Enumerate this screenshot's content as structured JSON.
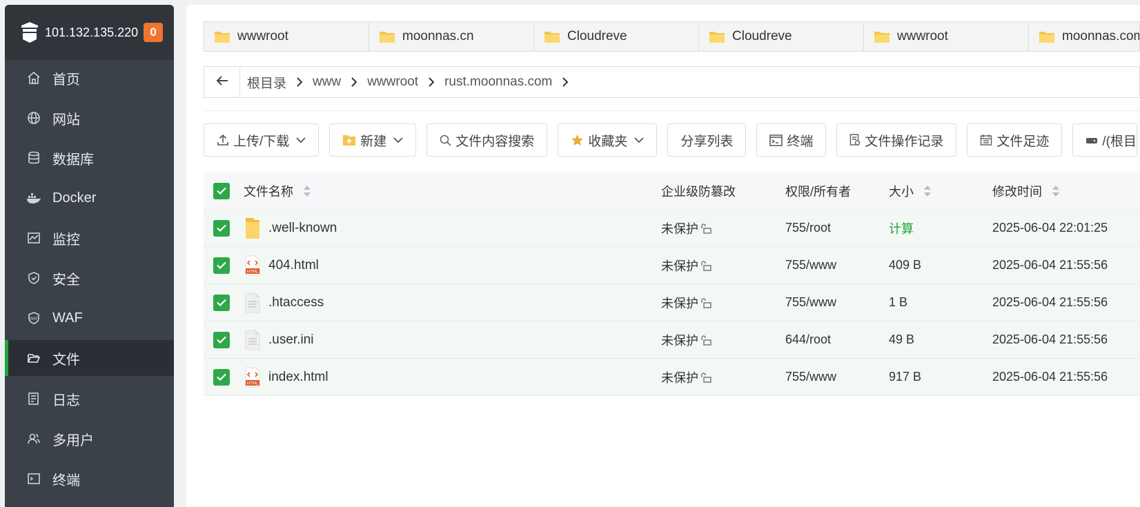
{
  "sidebar": {
    "host": "101.132.135.220",
    "badge": "0",
    "items": [
      {
        "label": "首页",
        "icon": "home-icon"
      },
      {
        "label": "网站",
        "icon": "globe-icon"
      },
      {
        "label": "数据库",
        "icon": "database-icon"
      },
      {
        "label": "Docker",
        "icon": "docker-icon"
      },
      {
        "label": "监控",
        "icon": "monitor-icon"
      },
      {
        "label": "安全",
        "icon": "shield-icon"
      },
      {
        "label": "WAF",
        "icon": "waf-icon"
      },
      {
        "label": "文件",
        "icon": "folder-open-icon",
        "active": true
      },
      {
        "label": "日志",
        "icon": "log-icon"
      },
      {
        "label": "多用户",
        "icon": "users-icon"
      },
      {
        "label": "终端",
        "icon": "terminal-icon"
      }
    ]
  },
  "tabs": [
    "wwwroot",
    "moonnas.cn",
    "Cloudreve",
    "Cloudreve",
    "wwwroot",
    "moonnas.com"
  ],
  "breadcrumb": [
    "根目录",
    "www",
    "wwwroot",
    "rust.moonnas.com"
  ],
  "toolbar": {
    "upload": "上传/下载",
    "new": "新建",
    "search": "文件内容搜索",
    "favorites": "收藏夹",
    "share": "分享列表",
    "terminal": "终端",
    "oplog": "文件操作记录",
    "footprint": "文件足迹",
    "disk": "/(根目"
  },
  "table": {
    "headers": {
      "name": "文件名称",
      "protect": "企业级防篡改",
      "perm": "权限/所有者",
      "size": "大小",
      "mtime": "修改时间"
    },
    "rows": [
      {
        "name": ".well-known",
        "type": "folder",
        "protect": "未保护",
        "perm": "755/root",
        "size": "计算",
        "mtime": "2025-06-04 22:01:25"
      },
      {
        "name": "404.html",
        "type": "html",
        "protect": "未保护",
        "perm": "755/www",
        "size": "409 B",
        "mtime": "2025-06-04 21:55:56"
      },
      {
        "name": ".htaccess",
        "type": "text",
        "protect": "未保护",
        "perm": "755/www",
        "size": "1 B",
        "mtime": "2025-06-04 21:55:56"
      },
      {
        "name": ".user.ini",
        "type": "text",
        "protect": "未保护",
        "perm": "644/root",
        "size": "49 B",
        "mtime": "2025-06-04 21:55:56"
      },
      {
        "name": "index.html",
        "type": "html",
        "protect": "未保护",
        "perm": "755/www",
        "size": "917 B",
        "mtime": "2025-06-04 21:55:56"
      }
    ]
  },
  "colors": {
    "accent": "#20a53a",
    "badge": "#f0752d",
    "sidebar": "#3b4149"
  }
}
